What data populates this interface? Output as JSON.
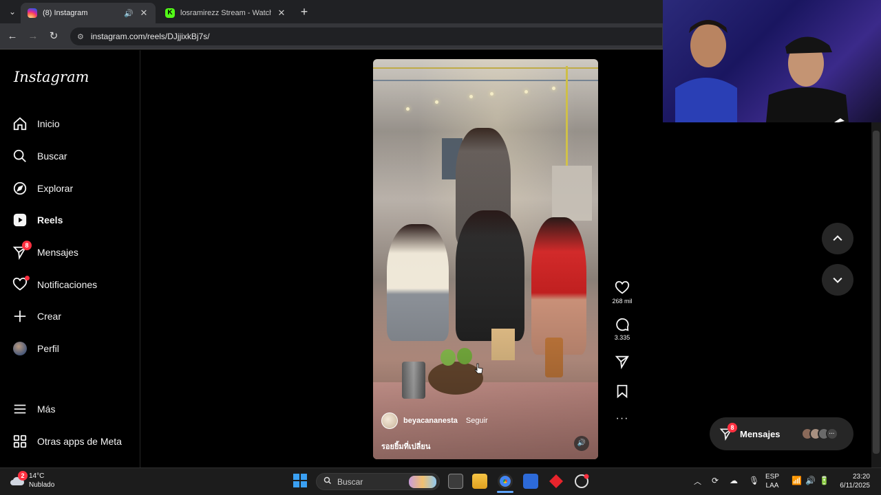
{
  "browser": {
    "tabs": [
      {
        "title": "(8) Instagram",
        "active": true
      },
      {
        "title": "losramirezz Stream - Watch Live",
        "active": false
      }
    ],
    "url": "instagram.com/reels/DJjjixkBj7s/"
  },
  "sidebar": {
    "logo": "Instagram",
    "items": [
      {
        "label": "Inicio",
        "icon": "home-icon"
      },
      {
        "label": "Buscar",
        "icon": "search-icon"
      },
      {
        "label": "Explorar",
        "icon": "compass-icon"
      },
      {
        "label": "Reels",
        "icon": "reels-icon"
      },
      {
        "label": "Mensajes",
        "icon": "messenger-icon",
        "badge": "8"
      },
      {
        "label": "Notificaciones",
        "icon": "heart-icon"
      },
      {
        "label": "Crear",
        "icon": "plus-icon"
      },
      {
        "label": "Perfil",
        "icon": "avatar"
      }
    ],
    "more": "Más",
    "meta_apps": "Otras apps de Meta"
  },
  "reel": {
    "author": "beyacananesta",
    "follow": "Seguir",
    "caption": "รอยยิ้มที่เปลี่ยน",
    "likes": "268 mil",
    "comments": "3.335"
  },
  "messages_pill": {
    "label": "Mensajes",
    "badge": "8"
  },
  "taskbar": {
    "weather_temp": "14°C",
    "weather_desc": "Nublado",
    "weather_badge": "2",
    "search_placeholder": "Buscar",
    "lang_top": "ESP",
    "lang_bottom": "LAA",
    "time": "23:20",
    "date": "6/11/2025"
  },
  "colors": {
    "accent_red": "#ff3040",
    "panel": "#262626",
    "background": "#000000"
  }
}
